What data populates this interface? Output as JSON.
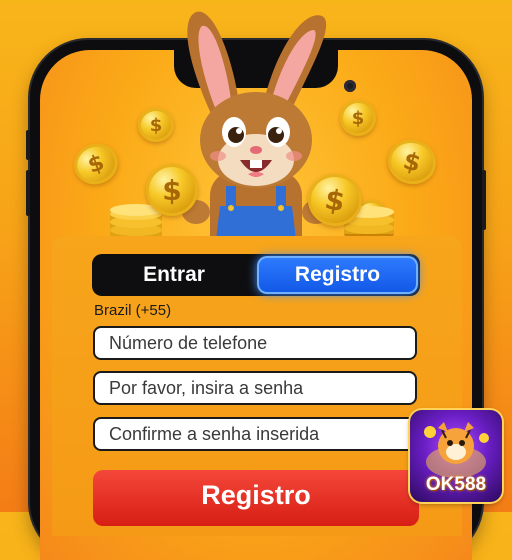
{
  "tabs": {
    "login_label": "Entrar",
    "register_label": "Registro"
  },
  "form": {
    "country_label": "Brazil (+55)",
    "phone_placeholder": "Número de telefone",
    "password_placeholder": "Por favor, insira a senha",
    "confirm_placeholder": "Confirme a senha inserida",
    "submit_label": "Registro"
  },
  "logo": {
    "text": "OK588"
  },
  "coin_symbol": "$",
  "colors": {
    "background_top": "#f8b51a",
    "background_bottom": "#f47d16",
    "active_tab": "#1157e6",
    "submit_button": "#d71e14",
    "logo_purple": "#6a1ec4"
  },
  "icons": [
    "bunny-mascot",
    "gold-coin",
    "ok588-logo"
  ]
}
